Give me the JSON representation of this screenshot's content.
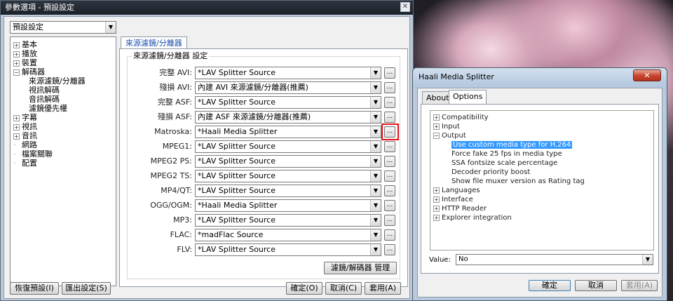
{
  "main_window": {
    "title": "參數選項 - 預設設定",
    "close_glyph": "✕",
    "profile_combo": "預設設定",
    "tree": [
      {
        "label": "基本",
        "expander": "+"
      },
      {
        "label": "播放",
        "expander": "+"
      },
      {
        "label": "裝置",
        "expander": "+"
      },
      {
        "label": "解碼器",
        "expander": "−"
      },
      {
        "label": "來源濾鏡/分離器",
        "expander": ""
      },
      {
        "label": "視訊解碼",
        "expander": ""
      },
      {
        "label": "音訊解碼",
        "expander": ""
      },
      {
        "label": "濾鏡優先權",
        "expander": ""
      },
      {
        "label": "字幕",
        "expander": "+"
      },
      {
        "label": "視訊",
        "expander": "+"
      },
      {
        "label": "音訊",
        "expander": "+"
      },
      {
        "label": "網路",
        "expander": ""
      },
      {
        "label": "檔案關聯",
        "expander": ""
      },
      {
        "label": "配置",
        "expander": ""
      }
    ],
    "tab_label": "來源濾鏡/分離器",
    "group_title": "來源濾鏡/分離器 設定",
    "rows": [
      {
        "label": "完整 AVI:",
        "value": "*LAV Splitter Source"
      },
      {
        "label": "殘損 AVI:",
        "value": "內建 AVI 來源濾鏡/分離器(推薦)"
      },
      {
        "label": "完整 ASF:",
        "value": "*LAV Splitter Source"
      },
      {
        "label": "殘損 ASF:",
        "value": "內建 ASF 來源濾鏡/分離器(推薦)"
      },
      {
        "label": "Matroska:",
        "value": "*Haali Media Splitter"
      },
      {
        "label": "MPEG1:",
        "value": "*LAV Splitter Source"
      },
      {
        "label": "MPEG2 PS:",
        "value": "*LAV Splitter Source"
      },
      {
        "label": "MPEG2 TS:",
        "value": "*LAV Splitter Source"
      },
      {
        "label": "MP4/QT:",
        "value": "*LAV Splitter Source"
      },
      {
        "label": "OGG/OGM:",
        "value": "*Haali Media Splitter"
      },
      {
        "label": "MP3:",
        "value": "*LAV Splitter Source"
      },
      {
        "label": "FLAC:",
        "value": "*madFlac Source"
      },
      {
        "label": "FLV:",
        "value": "*LAV Splitter Source"
      }
    ],
    "dots_label": "...",
    "manage_button": "濾鏡/解碼器 管理",
    "restore_button": "恢復預設(I)",
    "export_button": "匯出設定(S)",
    "ok_button": "確定(O)",
    "cancel_button": "取消(C)",
    "apply_button": "套用(A)"
  },
  "haali_window": {
    "title": "Haali Media Splitter",
    "close_glyph": "✕",
    "tabs": [
      "About",
      "Options"
    ],
    "tree": [
      {
        "label": "Compatibility",
        "expander": "+",
        "indent": 0,
        "selected": false
      },
      {
        "label": "Input",
        "expander": "+",
        "indent": 0,
        "selected": false
      },
      {
        "label": "Output",
        "expander": "−",
        "indent": 0,
        "selected": false
      },
      {
        "label": "Use custom media type for H.264",
        "expander": "",
        "indent": 1,
        "selected": true
      },
      {
        "label": "Force fake 25 fps in media type",
        "expander": "",
        "indent": 1,
        "selected": false
      },
      {
        "label": "SSA fontsize scale percentage",
        "expander": "",
        "indent": 1,
        "selected": false
      },
      {
        "label": "Decoder priority boost",
        "expander": "",
        "indent": 1,
        "selected": false
      },
      {
        "label": "Show file muxer version as Rating tag",
        "expander": "",
        "indent": 1,
        "selected": false
      },
      {
        "label": "Languages",
        "expander": "+",
        "indent": 0,
        "selected": false
      },
      {
        "label": "Interface",
        "expander": "+",
        "indent": 0,
        "selected": false
      },
      {
        "label": "HTTP Reader",
        "expander": "+",
        "indent": 0,
        "selected": false
      },
      {
        "label": "Explorer integration",
        "expander": "+",
        "indent": 0,
        "selected": false
      }
    ],
    "value_label": "Value:",
    "value_combo": "No",
    "ok_button": "確定",
    "cancel_button": "取消",
    "apply_button": "套用(A)"
  }
}
